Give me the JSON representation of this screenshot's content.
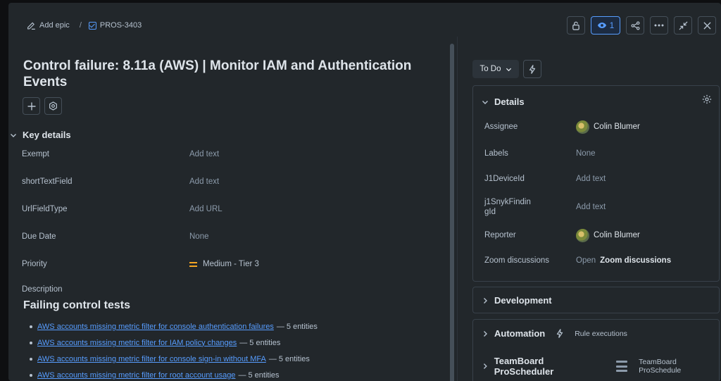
{
  "breadcrumb": {
    "add_epic": "Add epic",
    "separator": "/",
    "issue_key": "PROS-3403"
  },
  "toolbar": {
    "watch_count": "1"
  },
  "issue": {
    "title": "Control failure: 8.11a (AWS) | Monitor IAM and Authentication Events"
  },
  "key_details": {
    "heading": "Key details",
    "fields": [
      {
        "label": "Exempt",
        "value": "Add text"
      },
      {
        "label": "shortTextField",
        "value": "Add text"
      },
      {
        "label": "UrlFieldType",
        "value": "Add URL"
      },
      {
        "label": "Due Date",
        "value": "None"
      },
      {
        "label": "Priority",
        "value": "Medium - Tier 3",
        "icon": "medium-priority-icon",
        "icon_color": "#f5a623"
      }
    ]
  },
  "description": {
    "label": "Description",
    "heading": "Failing control tests",
    "items": [
      {
        "link": "AWS accounts missing metric filter for console authentication failures",
        "suffix": "— 5 entities"
      },
      {
        "link": "AWS accounts missing metric filter for IAM policy changes",
        "suffix": "— 5 entities"
      },
      {
        "link": "AWS accounts missing metric filter for console sign-in without MFA",
        "suffix": "— 5 entities"
      },
      {
        "link": "AWS accounts missing metric filter for root account usage",
        "suffix": "— 5 entities"
      }
    ]
  },
  "status": {
    "label": "To Do"
  },
  "details_panel": {
    "heading": "Details",
    "rows": [
      {
        "label": "Assignee",
        "value": "Colin Blumer"
      },
      {
        "label": "Labels",
        "value": "None"
      },
      {
        "label": "J1DeviceId",
        "value": "Add text"
      },
      {
        "label": "j1SnykFindin gId",
        "value": "Add text"
      },
      {
        "label": "Reporter",
        "value": "Colin Blumer"
      },
      {
        "label": "Zoom discussions",
        "value_prefix": "Open",
        "value_bold": "Zoom discussions"
      }
    ]
  },
  "development": {
    "heading": "Development"
  },
  "automation": {
    "heading": "Automation",
    "sub": "Rule executions"
  },
  "teamboard": {
    "heading": "TeamBoard ProScheduler",
    "sub": "TeamBoard ProSchedule"
  },
  "colors": {
    "accent": "#579dff",
    "background": "#22272b"
  }
}
